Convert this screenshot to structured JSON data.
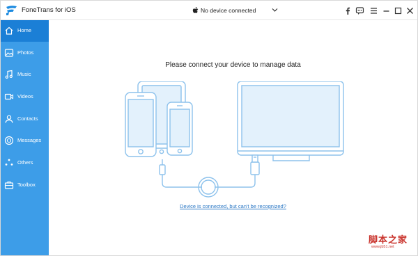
{
  "app": {
    "title": "FoneTrans for iOS",
    "brand_color": "#3d9de8",
    "active_color": "#1b7fd6"
  },
  "device_selector": {
    "label": "No device connected",
    "icon": "apple-icon"
  },
  "window_controls": [
    {
      "name": "facebook-icon"
    },
    {
      "name": "feedback-icon"
    },
    {
      "name": "menu-icon"
    },
    {
      "name": "minimize-icon"
    },
    {
      "name": "maximize-icon"
    },
    {
      "name": "close-icon"
    }
  ],
  "sidebar": {
    "items": [
      {
        "label": "Home",
        "icon": "home-icon",
        "active": true
      },
      {
        "label": "Photos",
        "icon": "photos-icon"
      },
      {
        "label": "Music",
        "icon": "music-icon"
      },
      {
        "label": "Videos",
        "icon": "videos-icon"
      },
      {
        "label": "Contacts",
        "icon": "contacts-icon"
      },
      {
        "label": "Messages",
        "icon": "messages-icon"
      },
      {
        "label": "Others",
        "icon": "others-icon"
      },
      {
        "label": "Toolbox",
        "icon": "toolbox-icon"
      }
    ]
  },
  "main": {
    "headline": "Please connect your device to manage data",
    "help_link": "Device is connected, but can't be recognized?"
  },
  "watermark": {
    "text": "脚本之家",
    "url": "www.jb51.net"
  }
}
